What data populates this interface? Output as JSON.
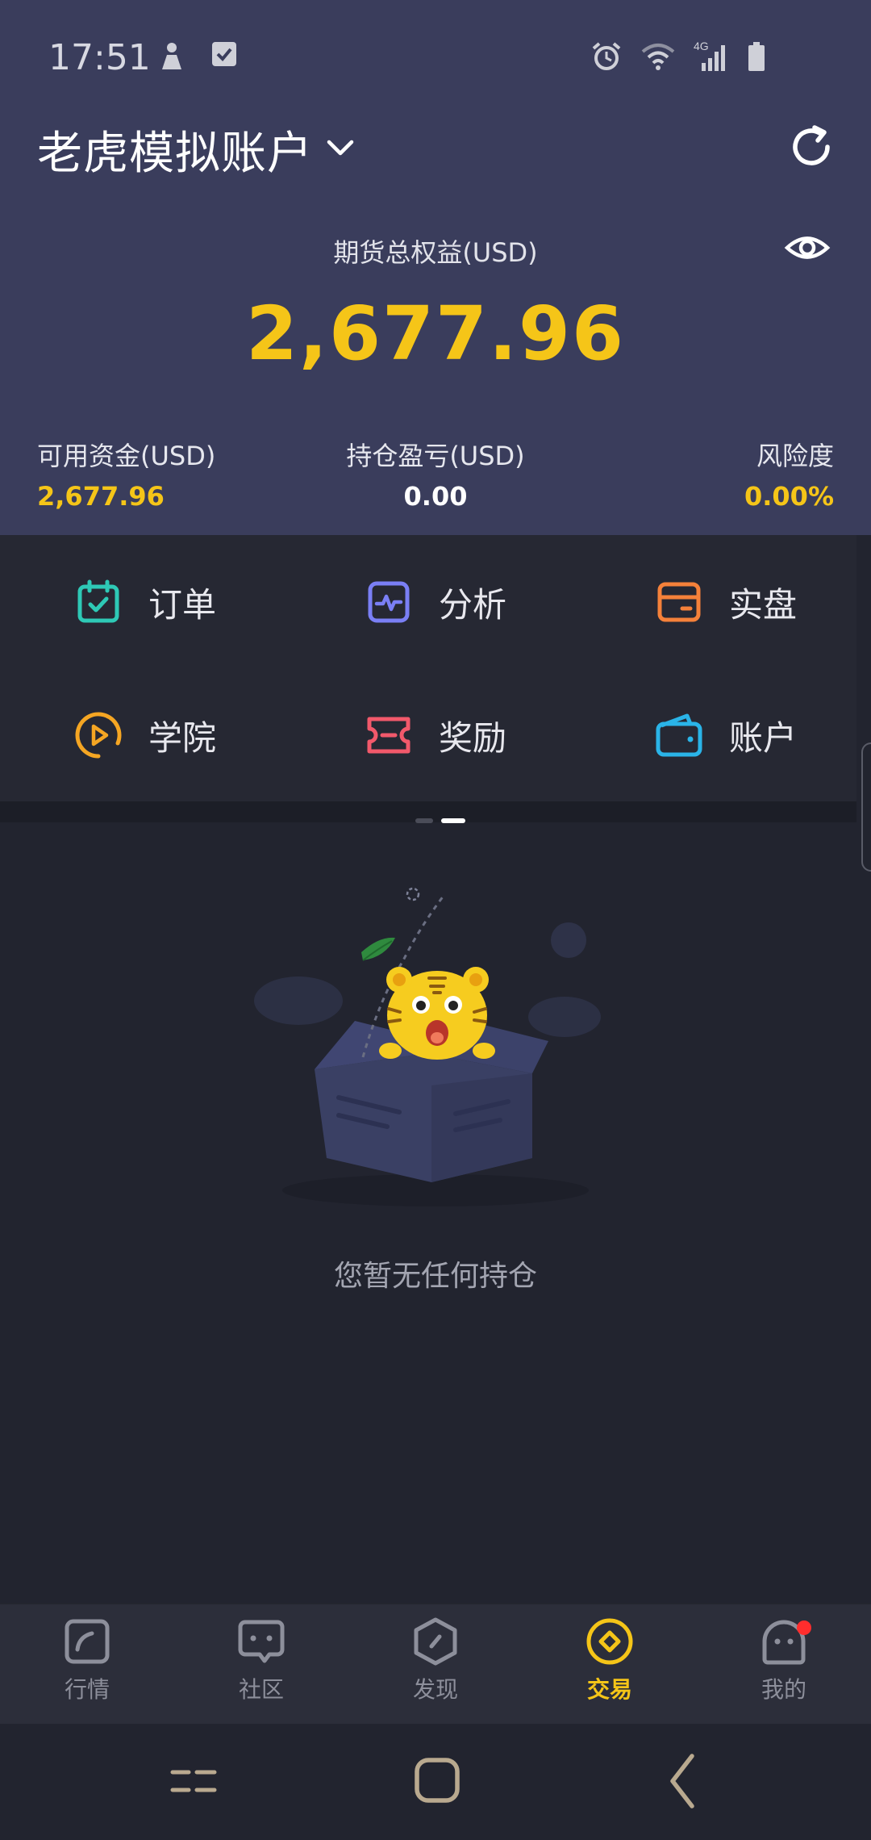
{
  "status_bar": {
    "time": "17:51",
    "network": "4G"
  },
  "account": {
    "name": "老虎模拟账户"
  },
  "equity": {
    "label": "期货总权益(USD)",
    "value": "2,677.96"
  },
  "stats": {
    "available": {
      "label": "可用资金(USD)",
      "value": "2,677.96"
    },
    "pnl": {
      "label": "持仓盈亏(USD)",
      "value": "0.00"
    },
    "risk": {
      "label": "风险度",
      "value": "0.00%"
    }
  },
  "shortcuts": [
    {
      "label": "订单",
      "icon": "calendar-check-icon",
      "color": "#2ec9b6"
    },
    {
      "label": "分析",
      "icon": "pulse-chart-icon",
      "color": "#7a7ff5"
    },
    {
      "label": "实盘",
      "icon": "card-icon",
      "color": "#f5813a"
    },
    {
      "label": "学院",
      "icon": "play-circle-icon",
      "color": "#f5a623"
    },
    {
      "label": "奖励",
      "icon": "ticket-icon",
      "color": "#f2596b"
    },
    {
      "label": "账户",
      "icon": "wallet-icon",
      "color": "#2ab4e8"
    }
  ],
  "empty_state": {
    "message": "您暂无任何持仓"
  },
  "bottom_nav": [
    {
      "label": "行情",
      "icon": "market-icon",
      "active": false
    },
    {
      "label": "社区",
      "icon": "community-icon",
      "active": false
    },
    {
      "label": "发现",
      "icon": "discover-icon",
      "active": false
    },
    {
      "label": "交易",
      "icon": "trade-icon",
      "active": true
    },
    {
      "label": "我的",
      "icon": "profile-icon",
      "active": false,
      "badge": true
    }
  ],
  "colors": {
    "header_bg": "#3a3d5c",
    "accent_yellow": "#f5c518",
    "page_bg": "#22242f"
  }
}
